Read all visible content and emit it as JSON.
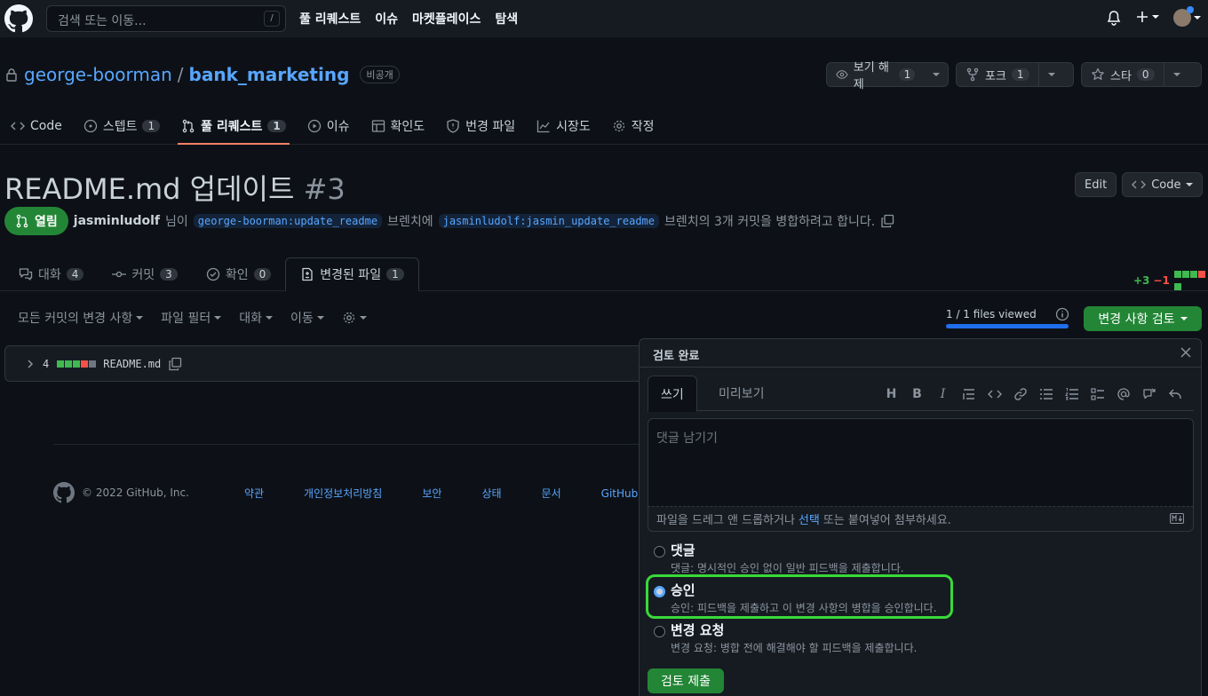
{
  "header": {
    "search_placeholder": "검색 또는 이동...",
    "search_shortcut": "/",
    "nav": [
      "풀 리퀘스트",
      "이슈",
      "마켓플레이스",
      "탐색"
    ]
  },
  "repo": {
    "owner": "george-boorman",
    "separator": "/",
    "name": "bank_marketing",
    "visibility": "비공개",
    "watch_label": "보기 해제",
    "watch_count": "1",
    "fork_label": "포크",
    "fork_count": "1",
    "star_label": "스타",
    "star_count": "0",
    "tabs": [
      {
        "label": "Code",
        "count": ""
      },
      {
        "label": "스텝트",
        "count": "1"
      },
      {
        "label": "풀 리퀘스트",
        "count": "1"
      },
      {
        "label": "이슈",
        "count": ""
      },
      {
        "label": "확인도",
        "count": ""
      },
      {
        "label": "번경 파일",
        "count": ""
      },
      {
        "label": "시장도",
        "count": ""
      },
      {
        "label": "작정",
        "count": ""
      }
    ]
  },
  "pr": {
    "title": "README.md 업데이트",
    "number": "#3",
    "edit_label": "Edit",
    "code_label": "Code",
    "state": "열림",
    "author": "jasminludolf",
    "text_1": "님이",
    "base_branch": "george-boorman:update_readme",
    "text_2": "브렌치에",
    "head_branch": "jasminludolf:jasmin_update_readme",
    "text_3": "브렌치의 3개 커밋을 병합하려고 합니다.",
    "tabs": [
      {
        "label": "대화",
        "count": "4"
      },
      {
        "label": "커밋",
        "count": "3"
      },
      {
        "label": "확인",
        "count": "0"
      },
      {
        "label": "변경된 파일",
        "count": "1"
      }
    ],
    "diff_add": "+3",
    "diff_del": "−1"
  },
  "files": {
    "toolbar": [
      "모든 커밋의 변경 사항",
      "파일 필터",
      "대화",
      "이동"
    ],
    "viewed_text": "1 / 1 files viewed",
    "viewed_fraction": 1,
    "review_button": "변경 사항 검토",
    "file_changes": "4",
    "file_name": "README.md"
  },
  "footer": {
    "copyright": "© 2022 GitHub, Inc.",
    "links": [
      "약관",
      "개인정보처리방침",
      "보안",
      "상태",
      "문서",
      "GitHub 문의"
    ]
  },
  "review": {
    "title": "검토 완료",
    "tab_write": "쓰기",
    "tab_preview": "미리보기",
    "tools": [
      "H",
      "B",
      "I"
    ],
    "placeholder": "댓글 남기기",
    "attach_before": "파일을 드레그 앤 드롭하거나",
    "attach_select": "선택",
    "attach_after": "또는 붙여넣어 첨부하세요.",
    "options": [
      {
        "label": "댓글",
        "desc": "댓글: 명시적인 승인 없이 일반 피드백을 제출합니다.",
        "checked": false
      },
      {
        "label": "승인",
        "desc": "승인: 피드백을 제출하고 이 변경 사항의 병합을 승인합니다.",
        "checked": true
      },
      {
        "label": "변경 요청",
        "desc": "변경 요청: 병합 전에 해결해야 할 피드백을 제출합니다.",
        "checked": false
      }
    ],
    "submit": "검토 제출"
  },
  "colors": {
    "background": "#0d1117",
    "accent_green": "#238636",
    "link_blue": "#58a6ff",
    "highlight_green": "#39d839",
    "tab_underline": "#f78166"
  }
}
